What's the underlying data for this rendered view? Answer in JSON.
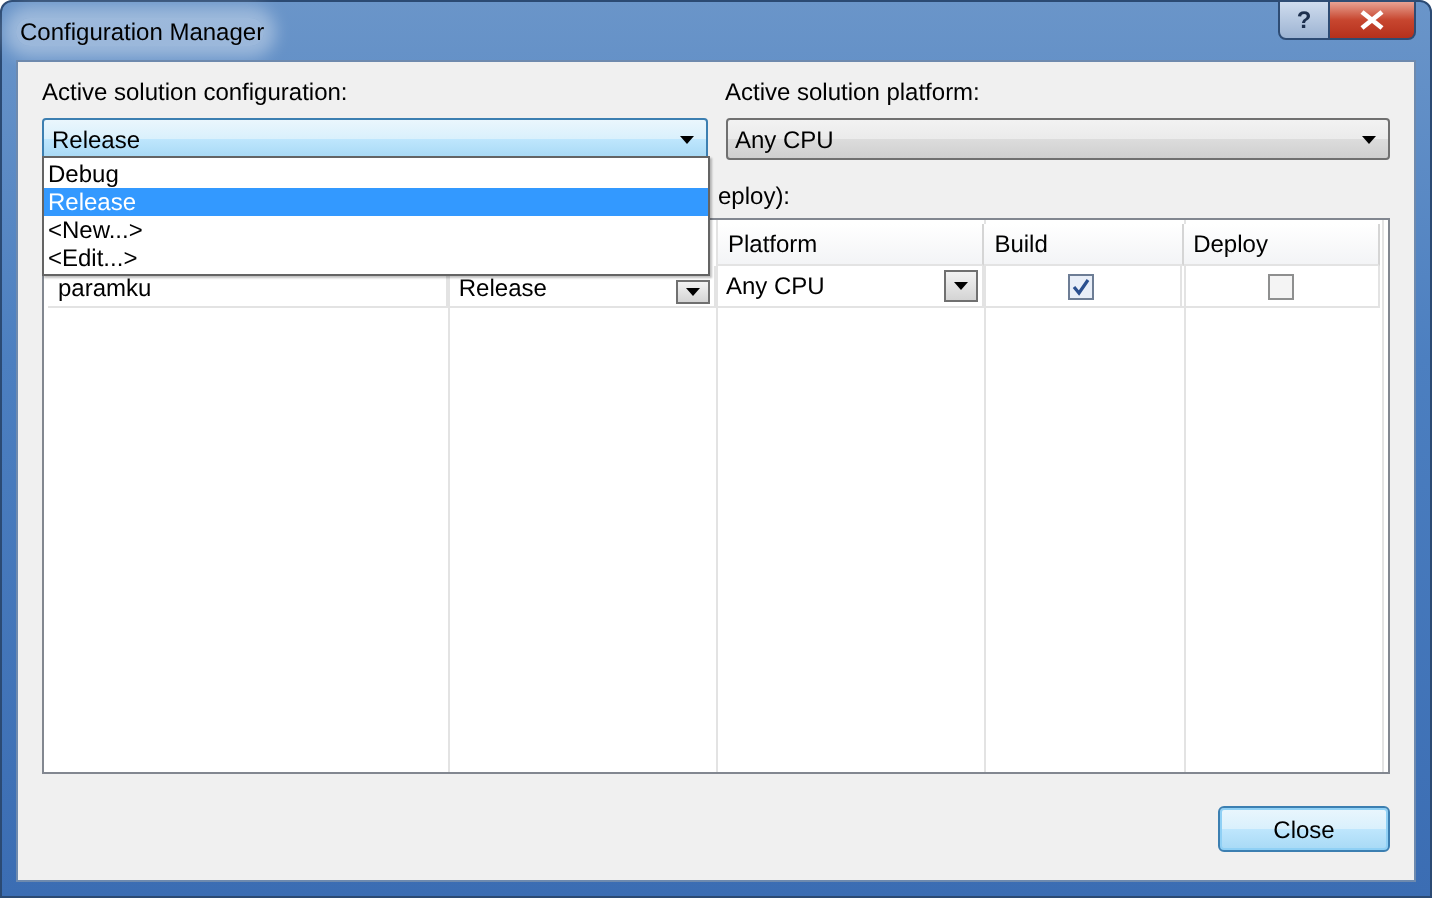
{
  "window": {
    "title": "Configuration Manager",
    "help": "?"
  },
  "configuration": {
    "label": "Active solution configuration:",
    "value": "Release",
    "focused": true,
    "options": [
      {
        "label": "Debug",
        "selected": false
      },
      {
        "label": "Release",
        "selected": true
      },
      {
        "label": "<New...>",
        "selected": false
      },
      {
        "label": "<Edit...>",
        "selected": false
      }
    ]
  },
  "platform": {
    "label": "Active solution platform:",
    "value": "Any CPU"
  },
  "contexts_label": "eploy):",
  "grid": {
    "columns": [
      "Platform",
      "Build",
      "Deploy"
    ],
    "rows": [
      {
        "project": "paramku",
        "configuration": "Release",
        "platform": "Any CPU",
        "build": true,
        "deploy": false
      }
    ]
  },
  "buttons": [
    "Close"
  ]
}
